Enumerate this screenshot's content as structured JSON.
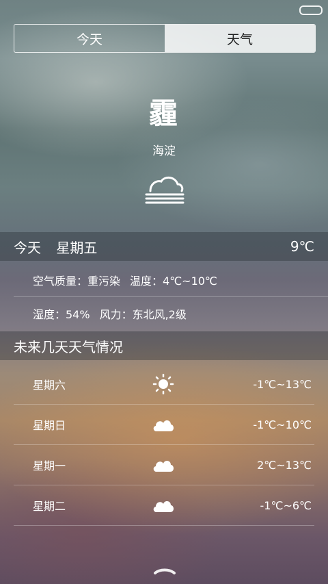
{
  "tabs": {
    "today": "今天",
    "weather": "天气",
    "active": "weather"
  },
  "current": {
    "condition": "霾",
    "location": "海淀",
    "icon": "haze-icon"
  },
  "today_bar": {
    "label": "今天",
    "weekday": "星期五",
    "temp": "9℃"
  },
  "details": {
    "air_quality": "空气质量：重污染",
    "temp_range": "温度：4℃~10℃",
    "humidity": "湿度：54%",
    "wind": "风力：东北风,2级"
  },
  "forecast_title": "未来几天天气情况",
  "forecast": [
    {
      "day": "星期六",
      "icon": "sun-icon",
      "temp": "-1℃~13℃"
    },
    {
      "day": "星期日",
      "icon": "cloud-icon",
      "temp": "-1℃~10℃"
    },
    {
      "day": "星期一",
      "icon": "cloud-icon",
      "temp": "2℃~13℃"
    },
    {
      "day": "星期二",
      "icon": "cloud-icon",
      "temp": "-1℃~6℃"
    }
  ]
}
